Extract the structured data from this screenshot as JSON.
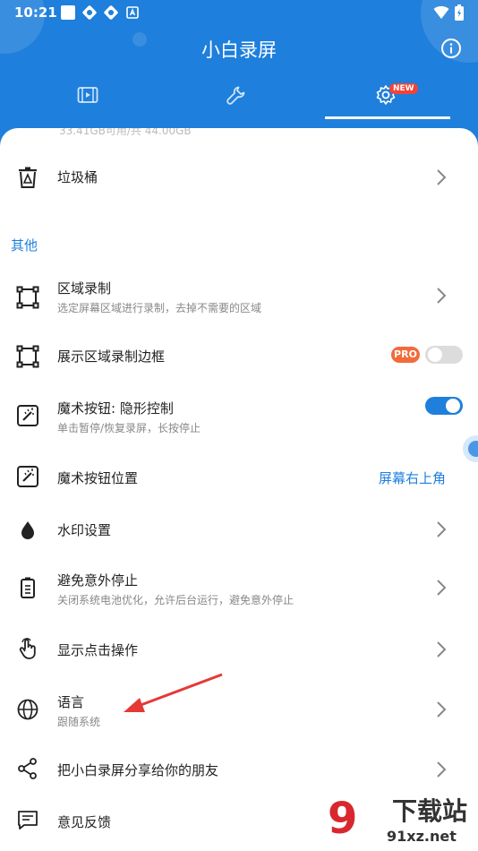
{
  "status_bar": {
    "time": "10:21"
  },
  "app": {
    "title": "小白录屏"
  },
  "tabs": [
    {
      "icon": "video-icon"
    },
    {
      "icon": "wrench-icon"
    },
    {
      "icon": "gear-icon",
      "badge": "NEW"
    }
  ],
  "storage_remnant": "33.41GB可用/共 44.00GB",
  "rows": {
    "trash": {
      "title": "垃圾桶"
    },
    "section_other": "其他",
    "area_record": {
      "title": "区域录制",
      "subtitle": "选定屏幕区域进行录制，去掉不需要的区域"
    },
    "show_area_border": {
      "title": "展示区域录制边框",
      "badge": "PRO",
      "toggle": "off"
    },
    "magic_button": {
      "title": "魔术按钮: 隐形控制",
      "subtitle": "单击暂停/恢复录屏，长按停止",
      "toggle": "on"
    },
    "magic_button_position": {
      "title": "魔术按钮位置",
      "value": "屏幕右上角"
    },
    "watermark_settings": {
      "title": "水印设置"
    },
    "avoid_stop": {
      "title": "避免意外停止",
      "subtitle": "关闭系统电池优化，允许后台运行，避免意外停止"
    },
    "show_touches": {
      "title": "显示点击操作"
    },
    "language": {
      "title": "语言",
      "subtitle": "跟随系统"
    },
    "share": {
      "title": "把小白录屏分享给你的朋友"
    },
    "feedback": {
      "title": "意见反馈"
    }
  },
  "watermark": {
    "big": "9",
    "brand": "下载站",
    "url": "91xz.net"
  },
  "colors": {
    "primary": "#1e7fdc",
    "pro": "#f26b3a",
    "arrow": "#e53935"
  }
}
